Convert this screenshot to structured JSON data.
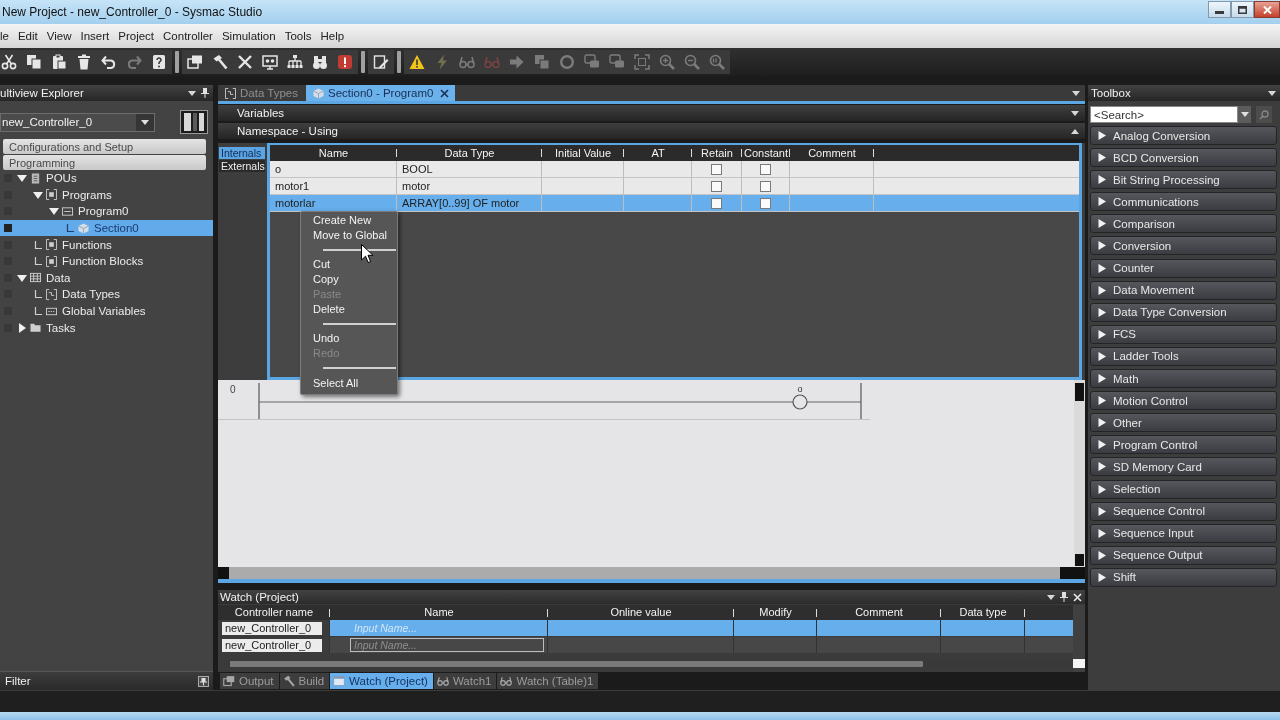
{
  "window": {
    "title": "New Project - new_Controller_0 - Sysmac Studio"
  },
  "menu": [
    "le",
    "Edit",
    "View",
    "Insert",
    "Project",
    "Controller",
    "Simulation",
    "Tools",
    "Help"
  ],
  "toolbar": {
    "groups": [
      {
        "items": [
          {
            "kind": "scissors",
            "disabled": false
          },
          {
            "kind": "copy",
            "disabled": false
          },
          {
            "kind": "paste",
            "disabled": false
          },
          {
            "kind": "trash",
            "disabled": false
          },
          {
            "kind": "undo",
            "disabled": false
          },
          {
            "kind": "redo",
            "disabled": true
          },
          {
            "kind": "help",
            "disabled": false
          }
        ]
      },
      {
        "items": [
          {
            "kind": "windows",
            "disabled": false
          },
          {
            "kind": "hammer",
            "disabled": false
          },
          {
            "kind": "cross",
            "disabled": false
          },
          {
            "kind": "monitor",
            "disabled": false
          },
          {
            "kind": "network",
            "disabled": false
          },
          {
            "kind": "binoculars",
            "disabled": false
          },
          {
            "kind": "stop",
            "disabled": false
          }
        ]
      },
      {
        "items": [
          {
            "kind": "edit",
            "disabled": false
          }
        ]
      },
      {
        "items": [
          {
            "kind": "warning",
            "disabled": false
          },
          {
            "kind": "bolt",
            "disabled": true
          },
          {
            "kind": "glasses",
            "disabled": true
          },
          {
            "kind": "glasses-red",
            "disabled": true
          },
          {
            "kind": "play",
            "disabled": true
          },
          {
            "kind": "stack",
            "disabled": true
          },
          {
            "kind": "ring",
            "disabled": true
          },
          {
            "kind": "chat",
            "disabled": true
          },
          {
            "kind": "chat",
            "disabled": true
          },
          {
            "kind": "frame",
            "disabled": true
          },
          {
            "kind": "zoom-in",
            "disabled": true
          },
          {
            "kind": "zoom-out",
            "disabled": true
          },
          {
            "kind": "zoom-reset",
            "disabled": true
          }
        ]
      }
    ]
  },
  "explorer": {
    "title": "ultiview Explorer",
    "controller": "new_Controller_0",
    "sections": [
      "Configurations and Setup",
      "Programming"
    ],
    "tree": [
      {
        "label": "POUs",
        "kind": "document",
        "expanded": true,
        "selected": false,
        "children": [
          {
            "label": "Programs",
            "kind": "brackets",
            "expanded": true,
            "selected": false,
            "children": [
              {
                "label": "Program0",
                "kind": "program",
                "expanded": true,
                "selected": false,
                "children": [
                  {
                    "label": "Section0",
                    "kind": "section",
                    "selected": true
                  }
                ]
              }
            ]
          },
          {
            "label": "Functions",
            "kind": "brackets",
            "selected": false
          },
          {
            "label": "Function Blocks",
            "kind": "brackets",
            "selected": false
          }
        ]
      },
      {
        "label": "Data",
        "kind": "table",
        "expanded": true,
        "selected": false,
        "children": [
          {
            "label": "Data Types",
            "kind": "types",
            "selected": false
          },
          {
            "label": "Global Variables",
            "kind": "variables",
            "selected": false
          }
        ]
      },
      {
        "label": "Tasks",
        "kind": "folder",
        "expanded": false,
        "selected": false
      }
    ],
    "filter": "Filter"
  },
  "editor_tabs": [
    {
      "label": "Data Types",
      "kind": "types",
      "selected": false,
      "closable": false
    },
    {
      "label": "Section0 - Program0",
      "kind": "section",
      "selected": true,
      "closable": true
    }
  ],
  "variables": {
    "headers": [
      {
        "label": "Variables",
        "expanded": true
      },
      {
        "label": "Namespace - Using",
        "expanded": false
      }
    ],
    "scopes": [
      {
        "label": "Internals",
        "selected": true
      },
      {
        "label": "Externals",
        "selected": false
      }
    ],
    "columns": [
      "Name",
      "Data Type",
      "Initial Value",
      "AT",
      "Retain",
      "Constant",
      "Comment"
    ],
    "rows": [
      {
        "name": "o",
        "data_type": "BOOL",
        "retain": false,
        "constant": false,
        "selected": false
      },
      {
        "name": "motor1",
        "data_type": "motor",
        "retain": false,
        "constant": false,
        "selected": false
      },
      {
        "name": "motorlar",
        "data_type": "ARRAY[0..99] OF motor",
        "retain": false,
        "constant": false,
        "selected": true
      }
    ]
  },
  "ladder": {
    "rungs": [
      {
        "number": "0",
        "coil": "o"
      }
    ]
  },
  "context_menu": {
    "items": [
      {
        "kind": "item",
        "label": "Create New",
        "disabled": false
      },
      {
        "kind": "item",
        "label": "Move to Global",
        "disabled": false
      },
      {
        "kind": "separator"
      },
      {
        "kind": "item",
        "label": "Cut",
        "disabled": false
      },
      {
        "kind": "item",
        "label": "Copy",
        "disabled": false
      },
      {
        "kind": "item",
        "label": "Paste",
        "disabled": true
      },
      {
        "kind": "item",
        "label": "Delete",
        "disabled": false
      },
      {
        "kind": "separator"
      },
      {
        "kind": "item",
        "label": "Undo",
        "disabled": false
      },
      {
        "kind": "item",
        "label": "Redo",
        "disabled": true
      },
      {
        "kind": "separator"
      },
      {
        "kind": "item",
        "label": "Select All",
        "disabled": false
      }
    ]
  },
  "watch": {
    "title": "Watch (Project)",
    "columns": [
      "Controller name",
      "Name",
      "Online value",
      "Modify",
      "Comment",
      "Data type"
    ],
    "rows": [
      {
        "controller": "new_Controller_0",
        "placeholder": "Input Name...",
        "selected": true
      },
      {
        "controller": "new_Controller_0",
        "placeholder": "Input Name...",
        "selected": false
      }
    ]
  },
  "output_tabs": [
    {
      "label": "Output",
      "kind": "windows",
      "selected": false
    },
    {
      "label": "Build",
      "kind": "hammer",
      "selected": false
    },
    {
      "label": "Watch (Project)",
      "kind": "window",
      "selected": true
    },
    {
      "label": "Watch1",
      "kind": "glasses",
      "selected": false
    },
    {
      "label": "Watch (Table)1",
      "kind": "glasses",
      "selected": false
    }
  ],
  "toolbox": {
    "title": "Toolbox",
    "search": {
      "placeholder": "<Search>"
    },
    "categories": [
      {
        "label": "Analog Conversion",
        "expanded": false
      },
      {
        "label": "BCD Conversion",
        "expanded": false
      },
      {
        "label": "Bit String Processing",
        "expanded": false
      },
      {
        "label": "Communications",
        "expanded": false
      },
      {
        "label": "Comparison",
        "expanded": false
      },
      {
        "label": "Conversion",
        "expanded": false
      },
      {
        "label": "Counter",
        "expanded": false
      },
      {
        "label": "Data Movement",
        "expanded": false
      },
      {
        "label": "Data Type Conversion",
        "expanded": false
      },
      {
        "label": "FCS",
        "expanded": false
      },
      {
        "label": "Ladder Tools",
        "expanded": false
      },
      {
        "label": "Math",
        "expanded": false
      },
      {
        "label": "Motion Control",
        "expanded": false
      },
      {
        "label": "Other",
        "expanded": false
      },
      {
        "label": "Program Control",
        "expanded": false
      },
      {
        "label": "SD Memory Card",
        "expanded": false
      },
      {
        "label": "Selection",
        "expanded": false
      },
      {
        "label": "Sequence Control",
        "expanded": false
      },
      {
        "label": "Sequence Input",
        "expanded": false
      },
      {
        "label": "Sequence Output",
        "expanded": false
      },
      {
        "label": "Shift",
        "expanded": false
      }
    ]
  }
}
